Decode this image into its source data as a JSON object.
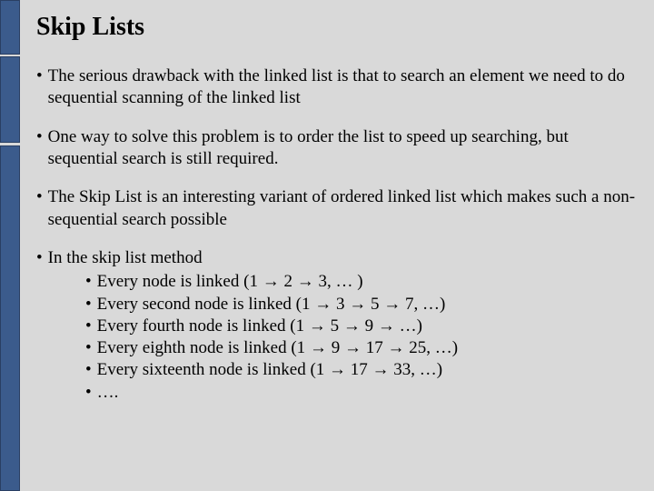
{
  "title": "Skip Lists",
  "arrow": "→",
  "bullets": {
    "b1": "The serious drawback with the linked list is that to search an element we need to do sequential scanning of the linked list",
    "b2": "One way to solve this problem is to order the list to speed up searching, but sequential search is still required.",
    "b3": "The Skip List is an interesting variant of ordered linked list which makes such a non-sequential search possible",
    "b4": "In the skip list method"
  },
  "sub": {
    "s1_pre": "Every node is linked (1 ",
    "s1_mid1": " 2 ",
    "s1_mid2": " 3, … )",
    "s2_pre": "Every second node is linked (1 ",
    "s2_mid1": " 3 ",
    "s2_mid2": " 5 ",
    "s2_mid3": " 7, …)",
    "s3_pre": "Every fourth node is linked (1 ",
    "s3_mid1": " 5 ",
    "s3_mid2": " 9 ",
    "s3_mid3": " …)",
    "s4_pre": "Every eighth node is linked (1 ",
    "s4_mid1": " 9 ",
    "s4_mid2": " 17 ",
    "s4_mid3": " 25, …)",
    "s5_pre": "Every sixteenth node is linked (1 ",
    "s5_mid1": " 17 ",
    "s5_mid2": " 33, …)",
    "s6": "…."
  },
  "dot": "•"
}
